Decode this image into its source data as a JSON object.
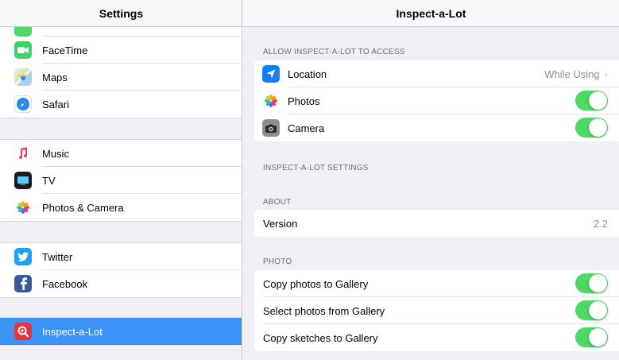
{
  "sidebar": {
    "title": "Settings",
    "group1": [
      {
        "label": "FaceTime",
        "icon": "facetime-icon"
      },
      {
        "label": "Maps",
        "icon": "maps-icon"
      },
      {
        "label": "Safari",
        "icon": "safari-icon"
      }
    ],
    "group2": [
      {
        "label": "Music",
        "icon": "music-icon"
      },
      {
        "label": "TV",
        "icon": "tv-icon"
      },
      {
        "label": "Photos & Camera",
        "icon": "photos-icon"
      }
    ],
    "group3": [
      {
        "label": "Twitter",
        "icon": "twitter-icon"
      },
      {
        "label": "Facebook",
        "icon": "facebook-icon"
      }
    ],
    "group4": [
      {
        "label": "Inspect-a-Lot",
        "icon": "inspect-a-lot-icon",
        "selected": true
      }
    ]
  },
  "detail": {
    "title": "Inspect-a-Lot",
    "access_header": "ALLOW INSPECT-A-LOT TO ACCESS",
    "access": {
      "location": {
        "label": "Location",
        "value": "While Using",
        "icon": "location-arrow-icon"
      },
      "photos": {
        "label": "Photos",
        "icon": "photos-icon",
        "enabled": true
      },
      "camera": {
        "label": "Camera",
        "icon": "camera-icon",
        "enabled": true
      }
    },
    "settings_header": "INSPECT-A-LOT SETTINGS",
    "about_header": "ABOUT",
    "about": {
      "version_label": "Version",
      "version_value": "2.2"
    },
    "photo_header": "PHOTO",
    "photo": {
      "copy_photos": {
        "label": "Copy photos to Gallery",
        "enabled": true
      },
      "select_photos": {
        "label": "Select photos from Gallery",
        "enabled": true
      },
      "copy_sketches": {
        "label": "Copy sketches to Gallery",
        "enabled": true
      }
    }
  },
  "colors": {
    "accent": "#3c94f6",
    "toggle_on": "#4cd964",
    "background": "#efeff4"
  }
}
